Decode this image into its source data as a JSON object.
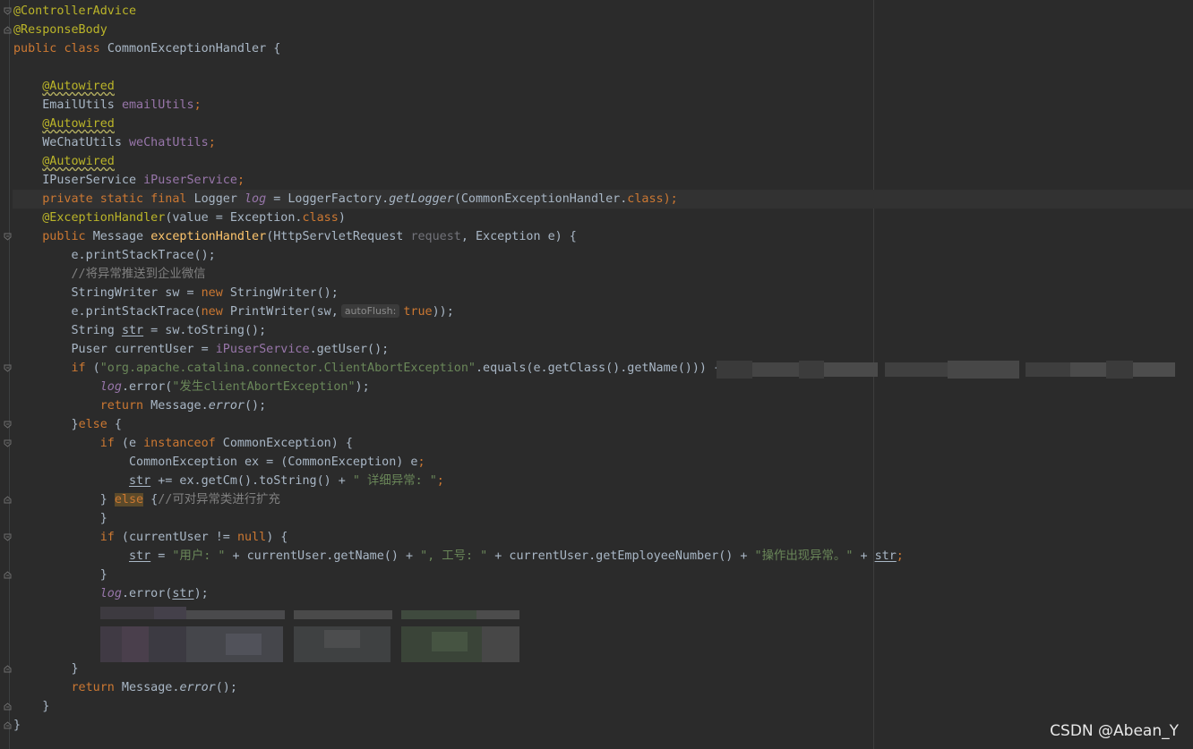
{
  "editor": {
    "line_annotation_controlleradvice": "@ControllerAdvice",
    "line_annotation_responsebody": "@ResponseBody",
    "kw_public": "public",
    "kw_class": "class",
    "class_name": "CommonExceptionHandler",
    "brace_open": "{",
    "brace_close": "}",
    "autowired": "@Autowired",
    "email_type": "EmailUtils",
    "email_field": "emailUtils",
    "wechat_type": "WeChatUtils",
    "wechat_field": "weChatUtils",
    "puser_type": "IPuserService",
    "puser_field": "iPuserService",
    "semicolon": ";",
    "kw_private_static_final": "private static final",
    "logger_type": "Logger",
    "log_field": "log",
    "logger_factory": "= LoggerFactory.",
    "get_logger": "getLogger",
    "logger_arg": "(CommonExceptionHandler.",
    "kw_class_suffix": "class",
    "close_paren_semicolon": ");",
    "exception_handler_ann": "@ExceptionHandler",
    "exception_handler_args": "(value = Exception.",
    "kw_class2": "class",
    "close_paren": ")",
    "method_kw": "public",
    "method_return": "Message",
    "method_name": "exceptionHandler",
    "method_params_1": "(HttpServletRequest ",
    "method_params_request": "request",
    "method_params_2": ", Exception e) {",
    "print_stack": "e.printStackTrace();",
    "comment_push": "//将异常推送到企业微信",
    "sw_decl": "StringWriter sw = ",
    "kw_new": "new",
    "sw_ctor": " StringWriter();",
    "print_stack2_a": "e.printStackTrace(",
    "print_stack2_b": " PrintWriter(sw,",
    "hint_autoflush": "autoFlush:",
    "kw_true": "true",
    "print_stack2_c": "));",
    "str_decl_a": "String ",
    "str_var": "str",
    "str_decl_b": " = sw.toString();",
    "puser_decl_a": "Puser currentUser = ",
    "puser_decl_b": ".getUser();",
    "kw_if": "if",
    "if_open": " (",
    "str_client_abort": "\"org.apache.catalina.connector.ClientAbortException\"",
    "if_equals": ".equals(e.getClass().getName())) {",
    "log_error_a": ".error(",
    "str_client_abort_msg": "\"发生clientAbortException\"",
    "kw_return": "return",
    "message_error_a": " Message.",
    "message_error_fn": "error",
    "message_error_b": "();",
    "else_close": "}",
    "kw_else": "else",
    "else_open": " {",
    "if_instanceof_a": " (e ",
    "kw_instanceof": "instanceof",
    "if_instanceof_b": " CommonException) {",
    "cast_line": "CommonException ex = (CommonException) e",
    "str_append_a": " += ex.getCm().toString() + ",
    "str_detail": "\" 详细异常: \"",
    "else_brace_open": "} ",
    "else_brace_after": " {",
    "comment_extend": "//可对异常类进行扩充",
    "if_user_a": " (currentUser != ",
    "kw_null": "null",
    "if_user_b": ") {",
    "str_assign_a": " = ",
    "str_user": "\"用户: \"",
    "user_concat_a": " + currentUser.getName() + ",
    "str_empno": "\", 工号: \"",
    "user_concat_b": " + currentUser.getEmployeeNumber() + ",
    "str_op_err": "\"操作出现异常。\"",
    "user_concat_c": " + ",
    "log_error_str_a": ".error(",
    "log_error_str_b": ");"
  },
  "watermark": "CSDN @Abean_Y"
}
